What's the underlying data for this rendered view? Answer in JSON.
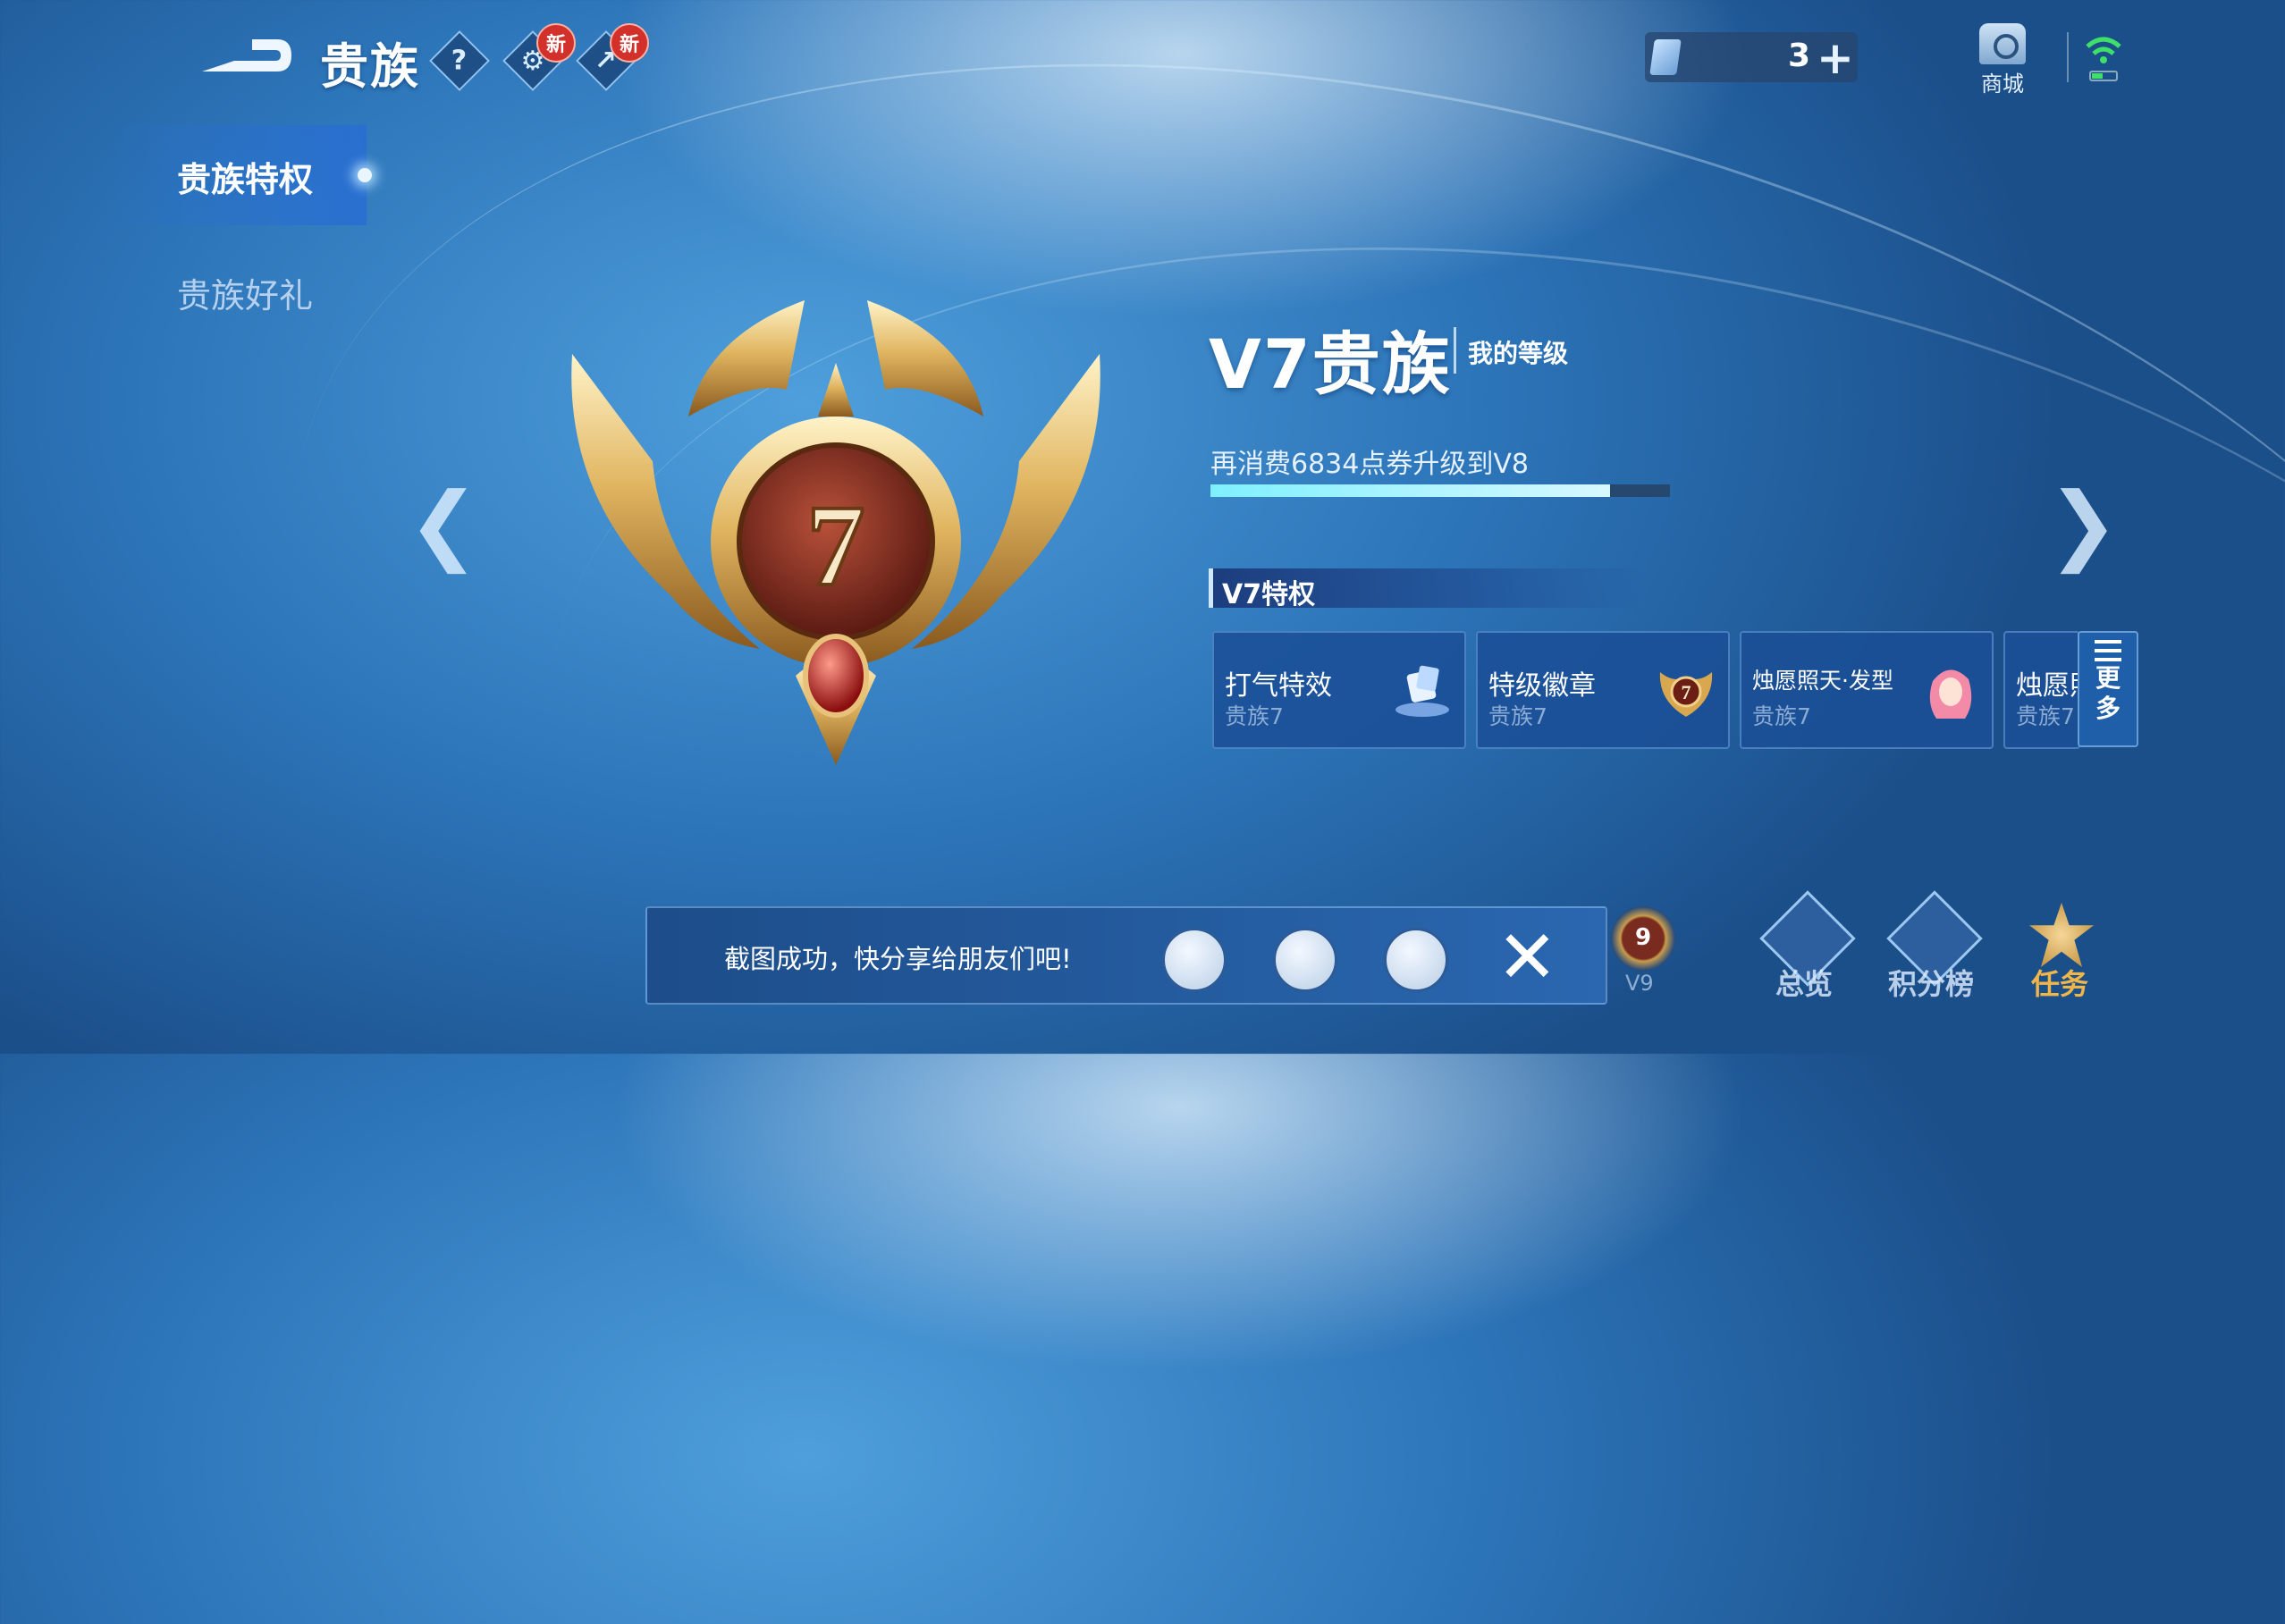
{
  "header": {
    "back_label": "",
    "title": "贵族",
    "help_icon": "question-icon",
    "new_badge": "新",
    "currency_count": "3",
    "currency_add": "+",
    "shop_label": "商城"
  },
  "sidebar": {
    "items": [
      {
        "label": "贵族特权",
        "selected": true
      },
      {
        "label": "贵族好礼",
        "selected": false
      }
    ]
  },
  "level": {
    "badge_number": "7",
    "title": "V7贵族",
    "my_level": "我的等级",
    "upgrade_hint": "再消费6834点券升级到V8",
    "progress": 0.87
  },
  "privileges": {
    "title": "V7特权",
    "cards": [
      {
        "name": "打气特效",
        "tier": "贵族7"
      },
      {
        "name": "特级徽章",
        "tier": "贵族7"
      },
      {
        "name": "烛愿照天·发型",
        "tier": "贵族7"
      },
      {
        "name": "烛愿照",
        "tier": "贵族7"
      }
    ],
    "more_label_1": "更",
    "more_label_2": "多"
  },
  "share_bar": {
    "message": "截图成功，快分享给朋友们吧!",
    "close": "✕"
  },
  "bottom_nav": {
    "v9_number": "9",
    "v9_label": "V9",
    "items": [
      {
        "label": "总览"
      },
      {
        "label": "积分榜"
      },
      {
        "label": "任务",
        "color": "#f0b64a"
      }
    ]
  },
  "colors": {
    "accent": "#2c74b8",
    "progress_fill": "#9ff3ff",
    "task": "#f0b64a"
  }
}
